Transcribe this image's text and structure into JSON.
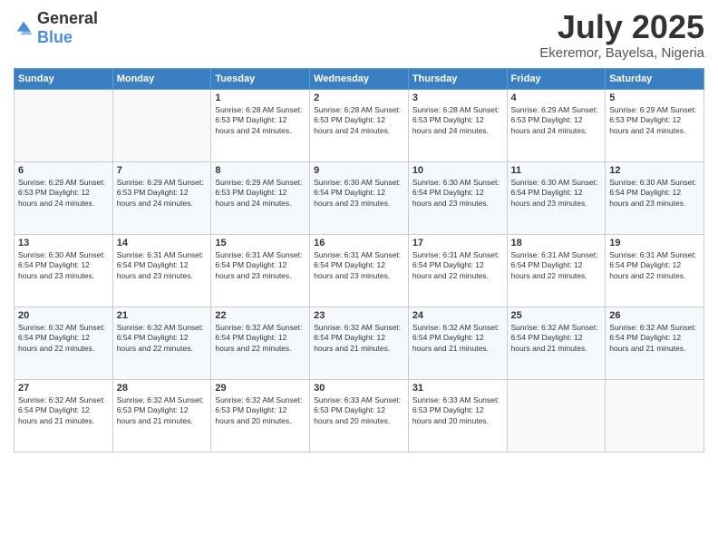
{
  "header": {
    "logo": {
      "general": "General",
      "blue": "Blue"
    },
    "title": "July 2025",
    "subtitle": "Ekeremor, Bayelsa, Nigeria"
  },
  "calendar": {
    "days_of_week": [
      "Sunday",
      "Monday",
      "Tuesday",
      "Wednesday",
      "Thursday",
      "Friday",
      "Saturday"
    ],
    "weeks": [
      [
        {
          "day": "",
          "info": ""
        },
        {
          "day": "",
          "info": ""
        },
        {
          "day": "1",
          "info": "Sunrise: 6:28 AM\nSunset: 6:53 PM\nDaylight: 12 hours\nand 24 minutes."
        },
        {
          "day": "2",
          "info": "Sunrise: 6:28 AM\nSunset: 6:53 PM\nDaylight: 12 hours\nand 24 minutes."
        },
        {
          "day": "3",
          "info": "Sunrise: 6:28 AM\nSunset: 6:53 PM\nDaylight: 12 hours\nand 24 minutes."
        },
        {
          "day": "4",
          "info": "Sunrise: 6:29 AM\nSunset: 6:53 PM\nDaylight: 12 hours\nand 24 minutes."
        },
        {
          "day": "5",
          "info": "Sunrise: 6:29 AM\nSunset: 6:53 PM\nDaylight: 12 hours\nand 24 minutes."
        }
      ],
      [
        {
          "day": "6",
          "info": "Sunrise: 6:29 AM\nSunset: 6:53 PM\nDaylight: 12 hours\nand 24 minutes."
        },
        {
          "day": "7",
          "info": "Sunrise: 6:29 AM\nSunset: 6:53 PM\nDaylight: 12 hours\nand 24 minutes."
        },
        {
          "day": "8",
          "info": "Sunrise: 6:29 AM\nSunset: 6:53 PM\nDaylight: 12 hours\nand 24 minutes."
        },
        {
          "day": "9",
          "info": "Sunrise: 6:30 AM\nSunset: 6:54 PM\nDaylight: 12 hours\nand 23 minutes."
        },
        {
          "day": "10",
          "info": "Sunrise: 6:30 AM\nSunset: 6:54 PM\nDaylight: 12 hours\nand 23 minutes."
        },
        {
          "day": "11",
          "info": "Sunrise: 6:30 AM\nSunset: 6:54 PM\nDaylight: 12 hours\nand 23 minutes."
        },
        {
          "day": "12",
          "info": "Sunrise: 6:30 AM\nSunset: 6:54 PM\nDaylight: 12 hours\nand 23 minutes."
        }
      ],
      [
        {
          "day": "13",
          "info": "Sunrise: 6:30 AM\nSunset: 6:54 PM\nDaylight: 12 hours\nand 23 minutes."
        },
        {
          "day": "14",
          "info": "Sunrise: 6:31 AM\nSunset: 6:54 PM\nDaylight: 12 hours\nand 23 minutes."
        },
        {
          "day": "15",
          "info": "Sunrise: 6:31 AM\nSunset: 6:54 PM\nDaylight: 12 hours\nand 23 minutes."
        },
        {
          "day": "16",
          "info": "Sunrise: 6:31 AM\nSunset: 6:54 PM\nDaylight: 12 hours\nand 23 minutes."
        },
        {
          "day": "17",
          "info": "Sunrise: 6:31 AM\nSunset: 6:54 PM\nDaylight: 12 hours\nand 22 minutes."
        },
        {
          "day": "18",
          "info": "Sunrise: 6:31 AM\nSunset: 6:54 PM\nDaylight: 12 hours\nand 22 minutes."
        },
        {
          "day": "19",
          "info": "Sunrise: 6:31 AM\nSunset: 6:54 PM\nDaylight: 12 hours\nand 22 minutes."
        }
      ],
      [
        {
          "day": "20",
          "info": "Sunrise: 6:32 AM\nSunset: 6:54 PM\nDaylight: 12 hours\nand 22 minutes."
        },
        {
          "day": "21",
          "info": "Sunrise: 6:32 AM\nSunset: 6:54 PM\nDaylight: 12 hours\nand 22 minutes."
        },
        {
          "day": "22",
          "info": "Sunrise: 6:32 AM\nSunset: 6:54 PM\nDaylight: 12 hours\nand 22 minutes."
        },
        {
          "day": "23",
          "info": "Sunrise: 6:32 AM\nSunset: 6:54 PM\nDaylight: 12 hours\nand 21 minutes."
        },
        {
          "day": "24",
          "info": "Sunrise: 6:32 AM\nSunset: 6:54 PM\nDaylight: 12 hours\nand 21 minutes."
        },
        {
          "day": "25",
          "info": "Sunrise: 6:32 AM\nSunset: 6:54 PM\nDaylight: 12 hours\nand 21 minutes."
        },
        {
          "day": "26",
          "info": "Sunrise: 6:32 AM\nSunset: 6:54 PM\nDaylight: 12 hours\nand 21 minutes."
        }
      ],
      [
        {
          "day": "27",
          "info": "Sunrise: 6:32 AM\nSunset: 6:54 PM\nDaylight: 12 hours\nand 21 minutes."
        },
        {
          "day": "28",
          "info": "Sunrise: 6:32 AM\nSunset: 6:53 PM\nDaylight: 12 hours\nand 21 minutes."
        },
        {
          "day": "29",
          "info": "Sunrise: 6:32 AM\nSunset: 6:53 PM\nDaylight: 12 hours\nand 20 minutes."
        },
        {
          "day": "30",
          "info": "Sunrise: 6:33 AM\nSunset: 6:53 PM\nDaylight: 12 hours\nand 20 minutes."
        },
        {
          "day": "31",
          "info": "Sunrise: 6:33 AM\nSunset: 6:53 PM\nDaylight: 12 hours\nand 20 minutes."
        },
        {
          "day": "",
          "info": ""
        },
        {
          "day": "",
          "info": ""
        }
      ]
    ]
  }
}
